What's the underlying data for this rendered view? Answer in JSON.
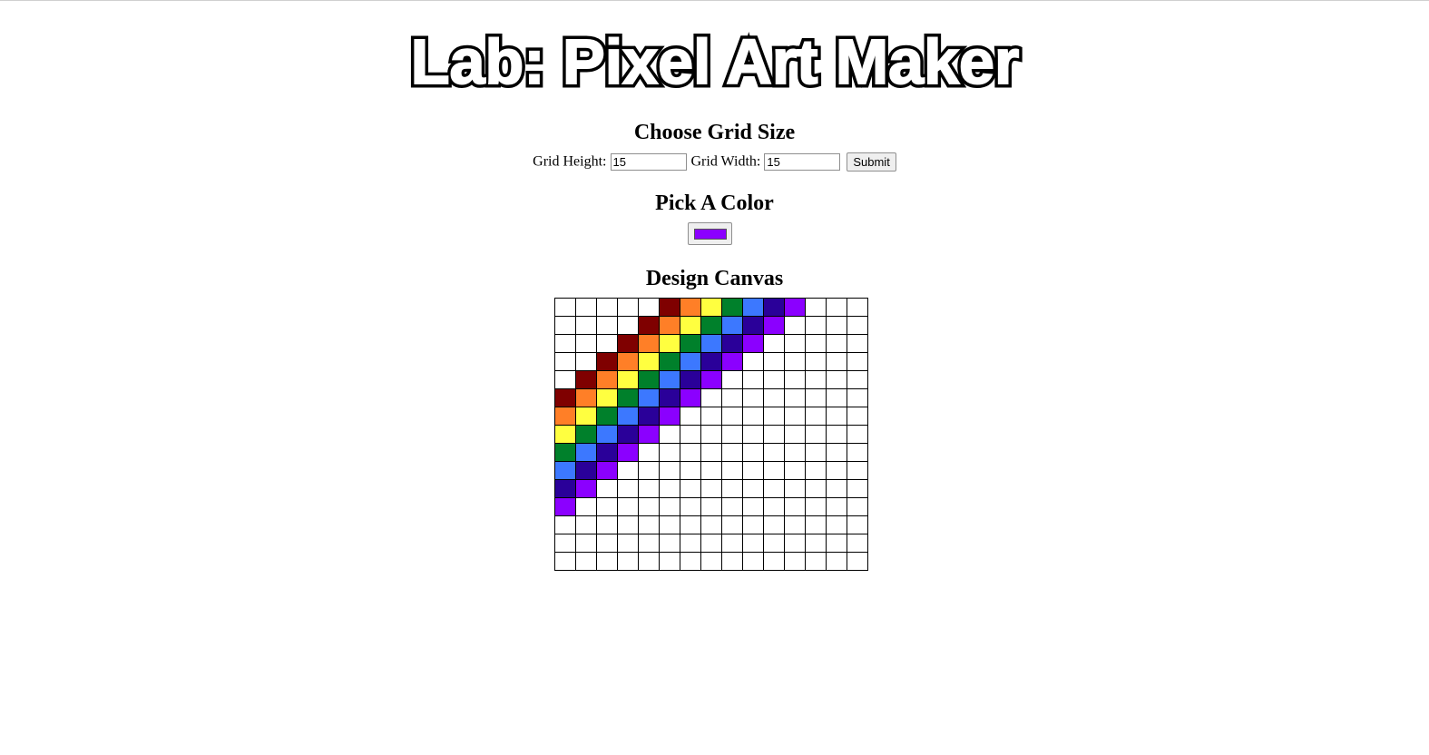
{
  "header": {
    "title": "Lab: Pixel Art Maker"
  },
  "grid_form": {
    "heading": "Choose Grid Size",
    "height_label": "Grid Height:",
    "height_value": "15",
    "width_label": "Grid Width:",
    "width_value": "15",
    "submit_label": "Submit"
  },
  "color_picker": {
    "heading": "Pick A Color",
    "value": "#8b00ff"
  },
  "canvas": {
    "heading": "Design Canvas",
    "rows": 15,
    "cols": 15,
    "palette": {
      "r": "#7f0000",
      "o": "#ff7f27",
      "y": "#ffff40",
      "g": "#00802b",
      "b": "#3c78ff",
      "i": "#2a0099",
      "v": "#8b00ff"
    },
    "pixels": [
      ".....roygbiv...",
      "....roygbiv....",
      "...roygbiv.....",
      "..roygbiv......",
      ".roygbiv.......",
      "roygbiv........",
      "oygbiv.........",
      "ygbiv..........",
      "gbiv...........",
      "biv............",
      "iv.............",
      "v..............",
      "...............",
      "...............",
      "..............."
    ]
  }
}
